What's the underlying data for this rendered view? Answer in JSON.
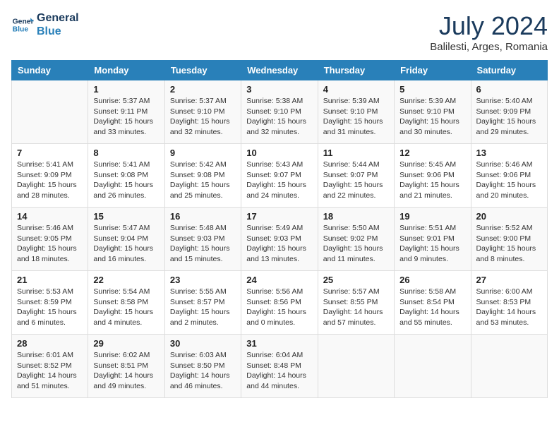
{
  "header": {
    "logo_line1": "General",
    "logo_line2": "Blue",
    "month_title": "July 2024",
    "location": "Balilesti, Arges, Romania"
  },
  "days_of_week": [
    "Sunday",
    "Monday",
    "Tuesday",
    "Wednesday",
    "Thursday",
    "Friday",
    "Saturday"
  ],
  "weeks": [
    [
      {
        "day": "",
        "info": ""
      },
      {
        "day": "1",
        "info": "Sunrise: 5:37 AM\nSunset: 9:11 PM\nDaylight: 15 hours\nand 33 minutes."
      },
      {
        "day": "2",
        "info": "Sunrise: 5:37 AM\nSunset: 9:10 PM\nDaylight: 15 hours\nand 32 minutes."
      },
      {
        "day": "3",
        "info": "Sunrise: 5:38 AM\nSunset: 9:10 PM\nDaylight: 15 hours\nand 32 minutes."
      },
      {
        "day": "4",
        "info": "Sunrise: 5:39 AM\nSunset: 9:10 PM\nDaylight: 15 hours\nand 31 minutes."
      },
      {
        "day": "5",
        "info": "Sunrise: 5:39 AM\nSunset: 9:10 PM\nDaylight: 15 hours\nand 30 minutes."
      },
      {
        "day": "6",
        "info": "Sunrise: 5:40 AM\nSunset: 9:09 PM\nDaylight: 15 hours\nand 29 minutes."
      }
    ],
    [
      {
        "day": "7",
        "info": "Sunrise: 5:41 AM\nSunset: 9:09 PM\nDaylight: 15 hours\nand 28 minutes."
      },
      {
        "day": "8",
        "info": "Sunrise: 5:41 AM\nSunset: 9:08 PM\nDaylight: 15 hours\nand 26 minutes."
      },
      {
        "day": "9",
        "info": "Sunrise: 5:42 AM\nSunset: 9:08 PM\nDaylight: 15 hours\nand 25 minutes."
      },
      {
        "day": "10",
        "info": "Sunrise: 5:43 AM\nSunset: 9:07 PM\nDaylight: 15 hours\nand 24 minutes."
      },
      {
        "day": "11",
        "info": "Sunrise: 5:44 AM\nSunset: 9:07 PM\nDaylight: 15 hours\nand 22 minutes."
      },
      {
        "day": "12",
        "info": "Sunrise: 5:45 AM\nSunset: 9:06 PM\nDaylight: 15 hours\nand 21 minutes."
      },
      {
        "day": "13",
        "info": "Sunrise: 5:46 AM\nSunset: 9:06 PM\nDaylight: 15 hours\nand 20 minutes."
      }
    ],
    [
      {
        "day": "14",
        "info": "Sunrise: 5:46 AM\nSunset: 9:05 PM\nDaylight: 15 hours\nand 18 minutes."
      },
      {
        "day": "15",
        "info": "Sunrise: 5:47 AM\nSunset: 9:04 PM\nDaylight: 15 hours\nand 16 minutes."
      },
      {
        "day": "16",
        "info": "Sunrise: 5:48 AM\nSunset: 9:03 PM\nDaylight: 15 hours\nand 15 minutes."
      },
      {
        "day": "17",
        "info": "Sunrise: 5:49 AM\nSunset: 9:03 PM\nDaylight: 15 hours\nand 13 minutes."
      },
      {
        "day": "18",
        "info": "Sunrise: 5:50 AM\nSunset: 9:02 PM\nDaylight: 15 hours\nand 11 minutes."
      },
      {
        "day": "19",
        "info": "Sunrise: 5:51 AM\nSunset: 9:01 PM\nDaylight: 15 hours\nand 9 minutes."
      },
      {
        "day": "20",
        "info": "Sunrise: 5:52 AM\nSunset: 9:00 PM\nDaylight: 15 hours\nand 8 minutes."
      }
    ],
    [
      {
        "day": "21",
        "info": "Sunrise: 5:53 AM\nSunset: 8:59 PM\nDaylight: 15 hours\nand 6 minutes."
      },
      {
        "day": "22",
        "info": "Sunrise: 5:54 AM\nSunset: 8:58 PM\nDaylight: 15 hours\nand 4 minutes."
      },
      {
        "day": "23",
        "info": "Sunrise: 5:55 AM\nSunset: 8:57 PM\nDaylight: 15 hours\nand 2 minutes."
      },
      {
        "day": "24",
        "info": "Sunrise: 5:56 AM\nSunset: 8:56 PM\nDaylight: 15 hours\nand 0 minutes."
      },
      {
        "day": "25",
        "info": "Sunrise: 5:57 AM\nSunset: 8:55 PM\nDaylight: 14 hours\nand 57 minutes."
      },
      {
        "day": "26",
        "info": "Sunrise: 5:58 AM\nSunset: 8:54 PM\nDaylight: 14 hours\nand 55 minutes."
      },
      {
        "day": "27",
        "info": "Sunrise: 6:00 AM\nSunset: 8:53 PM\nDaylight: 14 hours\nand 53 minutes."
      }
    ],
    [
      {
        "day": "28",
        "info": "Sunrise: 6:01 AM\nSunset: 8:52 PM\nDaylight: 14 hours\nand 51 minutes."
      },
      {
        "day": "29",
        "info": "Sunrise: 6:02 AM\nSunset: 8:51 PM\nDaylight: 14 hours\nand 49 minutes."
      },
      {
        "day": "30",
        "info": "Sunrise: 6:03 AM\nSunset: 8:50 PM\nDaylight: 14 hours\nand 46 minutes."
      },
      {
        "day": "31",
        "info": "Sunrise: 6:04 AM\nSunset: 8:48 PM\nDaylight: 14 hours\nand 44 minutes."
      },
      {
        "day": "",
        "info": ""
      },
      {
        "day": "",
        "info": ""
      },
      {
        "day": "",
        "info": ""
      }
    ]
  ]
}
